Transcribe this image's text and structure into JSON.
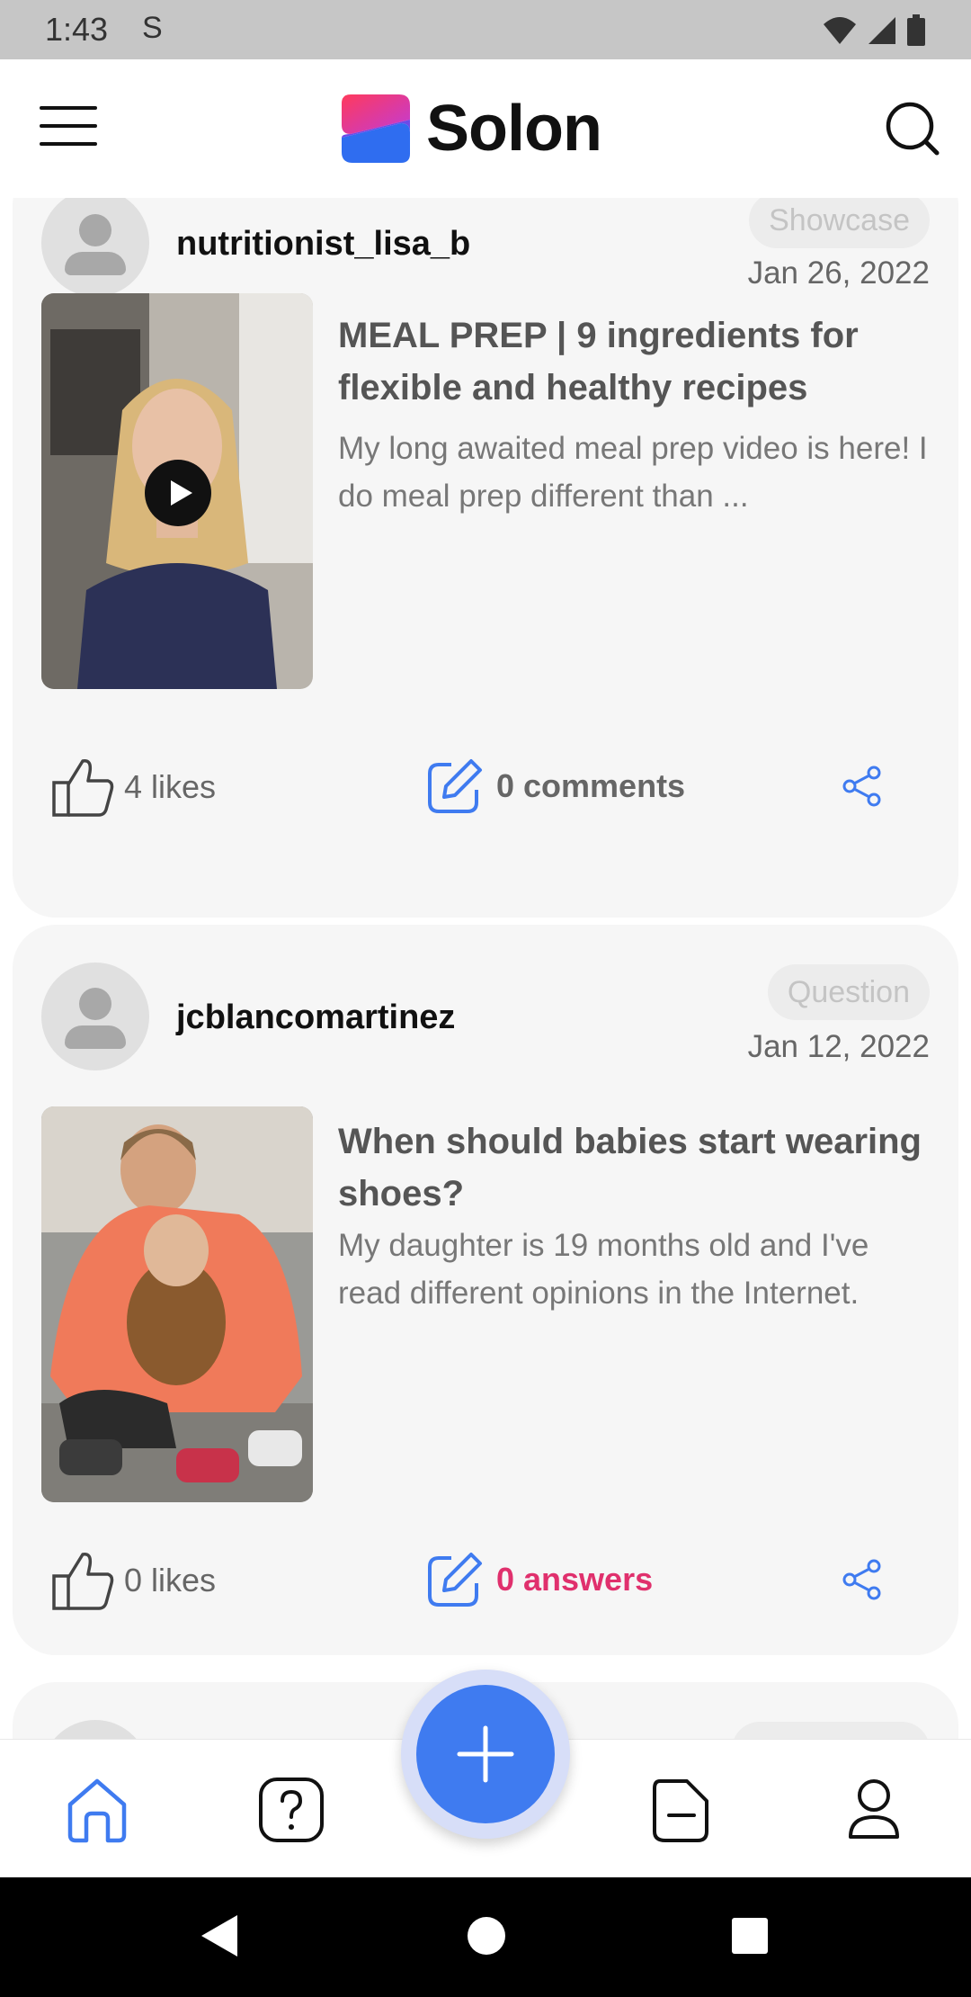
{
  "status_bar": {
    "time": "1:43",
    "carrier_icon": "S"
  },
  "header": {
    "app_name": "Solon"
  },
  "posts": [
    {
      "username": "nutritionist_lisa_b",
      "tag": "Showcase",
      "date": "Jan 26, 2022",
      "title": "MEAL PREP | 9 ingredients for flexible and healthy recipes",
      "excerpt": "My long awaited meal prep video is here! I do meal prep different than ...",
      "likes": "4 likes",
      "responses": "0 comments",
      "media": "video"
    },
    {
      "username": "jcblancomartinez",
      "tag": "Question",
      "date": "Jan 12, 2022",
      "title": "When should babies start wearing shoes?",
      "excerpt": "My daughter is 19 months old and I've read different opinions in the Internet.",
      "likes": "0 likes",
      "responses": "0 answers",
      "media": "photo"
    }
  ],
  "bottom_nav": [
    "home-icon",
    "question-icon",
    "add-icon",
    "articles-icon",
    "profile-icon"
  ],
  "colors": {
    "accent": "#3f7bf0",
    "answers": "#e0306d",
    "card_bg": "#f6f6f6"
  }
}
